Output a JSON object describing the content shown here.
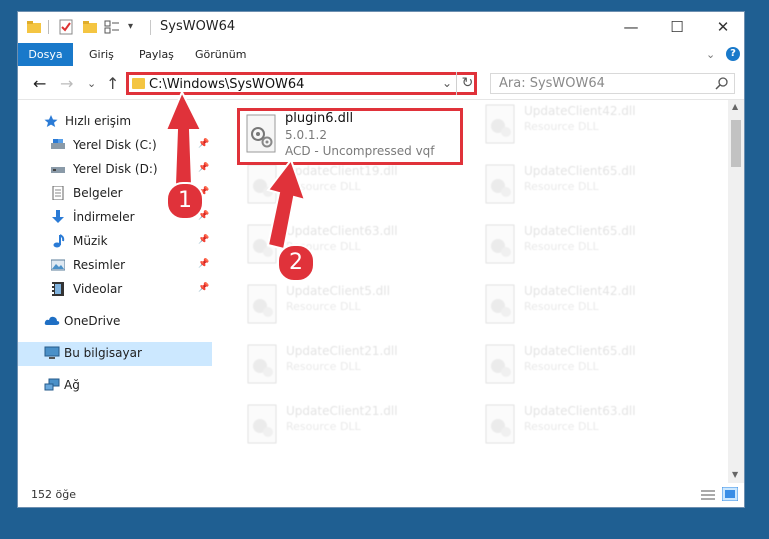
{
  "window": {
    "title": "SysWOW64",
    "controls": {
      "minimize": "—",
      "maximize": "☐",
      "close": "✕"
    }
  },
  "ribbon": {
    "tabs": [
      "Dosya",
      "Giriş",
      "Paylaş",
      "Görünüm"
    ],
    "expand": "⌄",
    "help": "?"
  },
  "address": {
    "path": "C:\\Windows\\SysWOW64",
    "dropdown": "⌄",
    "refresh": "↻",
    "search_placeholder": "Ara: SysWOW64",
    "back": "←",
    "forward": "→",
    "recent": "⌄",
    "up": "↑"
  },
  "sidebar": {
    "items": [
      {
        "label": "Hızlı erişim",
        "icon": "star-icon",
        "pinned": false
      },
      {
        "label": "Yerel Disk (C:)",
        "icon": "drive-icon",
        "pinned": true
      },
      {
        "label": "Yerel Disk (D:)",
        "icon": "drive-icon",
        "pinned": true
      },
      {
        "label": "Belgeler",
        "icon": "document-icon",
        "pinned": true
      },
      {
        "label": "İndirmeler",
        "icon": "download-icon",
        "pinned": true
      },
      {
        "label": "Müzik",
        "icon": "music-icon",
        "pinned": true
      },
      {
        "label": "Resimler",
        "icon": "pictures-icon",
        "pinned": true
      },
      {
        "label": "Videolar",
        "icon": "video-icon",
        "pinned": true
      },
      {
        "label": "OneDrive",
        "icon": "cloud-icon",
        "pinned": false
      },
      {
        "label": "Bu bilgisayar",
        "icon": "computer-icon",
        "pinned": false
      },
      {
        "label": "Ağ",
        "icon": "network-icon",
        "pinned": false
      }
    ],
    "pin_glyph": "📌"
  },
  "files": {
    "highlighted": {
      "name": "plugin6.dll",
      "version": "5.0.1.2",
      "type": "ACD - Uncompressed vqf"
    },
    "left_column": [
      {
        "name": "UpdateClient19.dll",
        "type": "Resource DLL"
      },
      {
        "name": "UpdateClient63.dll",
        "type": "Resource DLL"
      },
      {
        "name": "UpdateClient5.dll",
        "type": "Resource DLL"
      },
      {
        "name": "UpdateClient21.dll",
        "type": "Resource DLL"
      },
      {
        "name": "UpdateClient21.dll",
        "type": "Resource DLL"
      }
    ],
    "right_column": [
      {
        "name": "UpdateClient42.dll",
        "type": "Resource DLL"
      },
      {
        "name": "UpdateClient65.dll",
        "type": "Resource DLL"
      },
      {
        "name": "UpdateClient65.dll",
        "type": "Resource DLL"
      },
      {
        "name": "UpdateClient42.dll",
        "type": "Resource DLL"
      },
      {
        "name": "UpdateClient65.dll",
        "type": "Resource DLL"
      },
      {
        "name": "UpdateClient63.dll",
        "type": "Resource DLL"
      }
    ]
  },
  "status": {
    "count": "152 öğe"
  },
  "annotations": {
    "step1": "1",
    "step2": "2",
    "color": "#e0323a"
  }
}
